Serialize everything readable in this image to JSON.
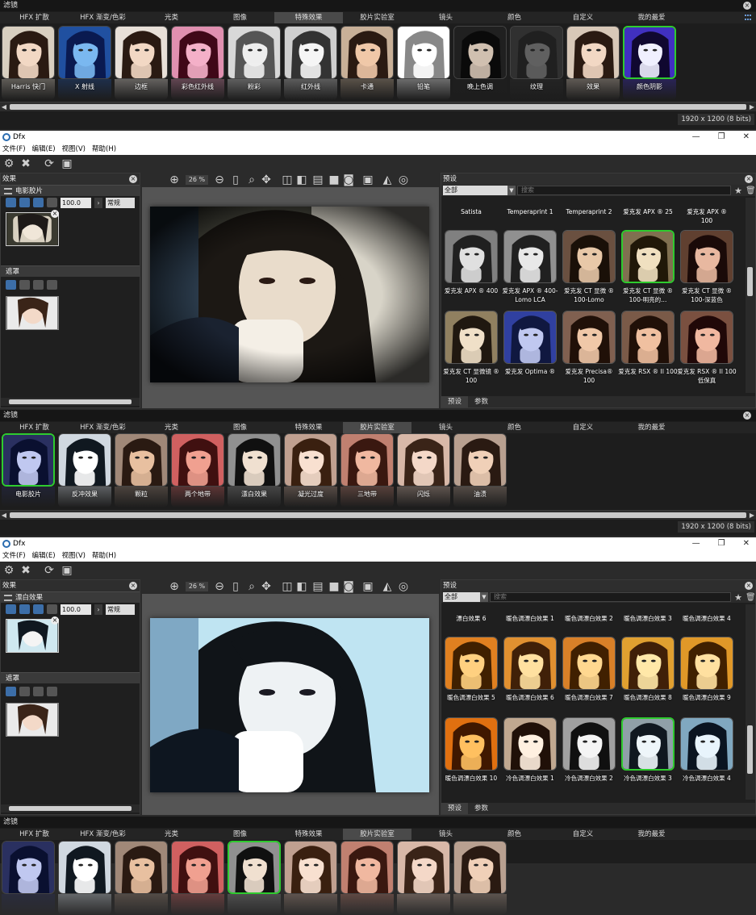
{
  "strip1": {
    "title": "滤镜",
    "tabs": [
      "HFX 扩散",
      "HFX 渐变/色彩",
      "光类",
      "图像",
      "特殊效果",
      "胶片实验室",
      "镜头",
      "颜色",
      "自定义",
      "我的最爱"
    ],
    "active_tab": 4,
    "items": [
      "Harris 快门",
      "X 射线",
      "边框",
      "彩色红外线",
      "粉彩",
      "红外线",
      "卡通",
      "铅笔",
      "晚上色调",
      "纹理",
      "效果",
      "颜色阴影"
    ],
    "selected_index": 11,
    "status": "1920 x 1200 (8 bits)"
  },
  "window1": {
    "app_title": "Dfx",
    "menus": [
      "文件(F)",
      "编辑(E)",
      "视图(V)",
      "帮助(H)"
    ],
    "effects_panel_title": "效果",
    "effect_name": "电影胶片",
    "opacity": "100.0",
    "blend_mode": "常规",
    "mask_section": "遮罩",
    "zoom": "26 %",
    "presets_title": "预设",
    "category": "全部",
    "search_placeholder": "搜索",
    "top_row": [
      "Satista",
      "Temperaprint 1",
      "Temperaprint 2",
      "爱克发 APX ® 25",
      "爱克发 APX ® 100"
    ],
    "presets": [
      "爱克发 APX ® 400",
      "爱克发 APX ® 400-Lomo LCA",
      "爱克发 CT 显微 ® 100-Lomo",
      "爱克发 CT 显微 ® 100-明亮的...",
      "爱克发 CT 显微 ® 100-深蓝色",
      "爱克发 CT 显微镜 ® 100",
      "爱克发 Optima ®",
      "爱克发 Precisa® 100",
      "爱克发 RSX ® II 100",
      "爱克发 RSX ® II 100 低保真"
    ],
    "selected_preset": 3,
    "tab_presets": "预设",
    "tab_params": "参数"
  },
  "strip2": {
    "title": "滤镜",
    "tabs": [
      "HFX 扩散",
      "HFX 渐变/色彩",
      "光类",
      "图像",
      "特殊效果",
      "胶片实验室",
      "镜头",
      "颜色",
      "自定义",
      "我的最爱"
    ],
    "active_tab": 5,
    "items": [
      "电影胶片",
      "反冲效果",
      "颗粒",
      "两个地带",
      "漂白效果",
      "凝光过度",
      "三地带",
      "闪烁",
      "油渍"
    ],
    "selected_index": 0,
    "status": "1920 x 1200 (8 bits)"
  },
  "window2": {
    "app_title": "Dfx",
    "menus": [
      "文件(F)",
      "编辑(E)",
      "视图(V)",
      "帮助(H)"
    ],
    "effects_panel_title": "效果",
    "effect_name": "漂白效果",
    "opacity": "100.0",
    "blend_mode": "常规",
    "mask_section": "遮罩",
    "zoom": "26 %",
    "presets_title": "预设",
    "category": "全部",
    "search_placeholder": "搜索",
    "top_row": [
      "漂白效果 6",
      "暖色调漂白效果 1",
      "暖色调漂白效果 2",
      "暖色调漂白效果 3",
      "暖色调漂白效果 4"
    ],
    "presets": [
      "暖色调漂白效果 5",
      "暖色调漂白效果 6",
      "暖色调漂白效果 7",
      "暖色调漂白效果 8",
      "暖色调漂白效果 9",
      "暖色调漂白效果 10",
      "冷色调漂白效果 1",
      "冷色调漂白效果 2",
      "冷色调漂白效果 3",
      "冷色调漂白效果 4"
    ],
    "selected_preset": 8,
    "tab_presets": "预设",
    "tab_params": "参数"
  },
  "strip3": {
    "title": "滤镜",
    "tabs": [
      "HFX 扩散",
      "HFX 渐变/色彩",
      "光类",
      "图像",
      "特殊效果",
      "胶片实验室",
      "镜头",
      "颜色",
      "自定义",
      "我的最爱"
    ],
    "active_tab": 5
  },
  "colors": {
    "accent_selected": "#2ecb2e",
    "panel_bg": "#1f1f1f",
    "active_tab": "#4a4a4a"
  }
}
